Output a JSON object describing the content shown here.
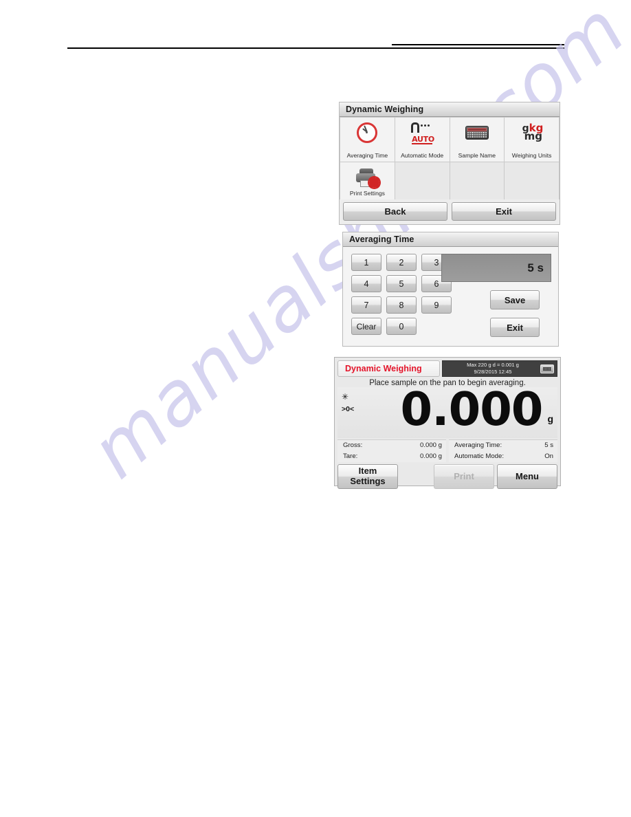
{
  "watermark": {
    "text": "manualshive.com"
  },
  "menu_panel": {
    "title": "Dynamic Weighing",
    "tiles": [
      {
        "label": "Averaging Time",
        "icon": "clock-icon"
      },
      {
        "label": "Automatic Mode",
        "icon": "auto-mode-icon"
      },
      {
        "label": "Sample Name",
        "icon": "keyboard-icon"
      },
      {
        "label": "Weighing Units",
        "icon": "weighing-units-icon"
      },
      {
        "label": "Print Settings",
        "icon": "printer-settings-icon"
      }
    ],
    "units_icon": {
      "g": "g",
      "kg": "kg",
      "mg": "mg"
    },
    "auto_icon_text": "AUTO",
    "back_label": "Back",
    "exit_label": "Exit"
  },
  "keypad_panel": {
    "title": "Averaging Time",
    "keys": [
      "1",
      "2",
      "3",
      "4",
      "5",
      "6",
      "7",
      "8",
      "9",
      "Clear",
      "0"
    ],
    "value": "5 s",
    "save_label": "Save",
    "exit_label": "Exit"
  },
  "screen_panel": {
    "app_name": "Dynamic Weighing",
    "capacity_line": "Max 220 g   d = 0.001 g",
    "datetime_line": "9/28/2015   12:45",
    "instruction": "Place sample on the pan to begin averaging.",
    "stability_flag": "✳",
    "zero_flag": ">0<",
    "weight_value": "0.000",
    "weight_unit": "g",
    "info_left": [
      {
        "label": "Gross:",
        "value": "0.000 g"
      },
      {
        "label": "Tare:",
        "value": "0.000 g"
      }
    ],
    "info_right": [
      {
        "label": "Averaging Time:",
        "value": "5 s"
      },
      {
        "label": "Automatic Mode:",
        "value": "On"
      }
    ],
    "item_settings_line1": "Item",
    "item_settings_line2": "Settings",
    "print_label": "Print",
    "menu_label": "Menu"
  }
}
